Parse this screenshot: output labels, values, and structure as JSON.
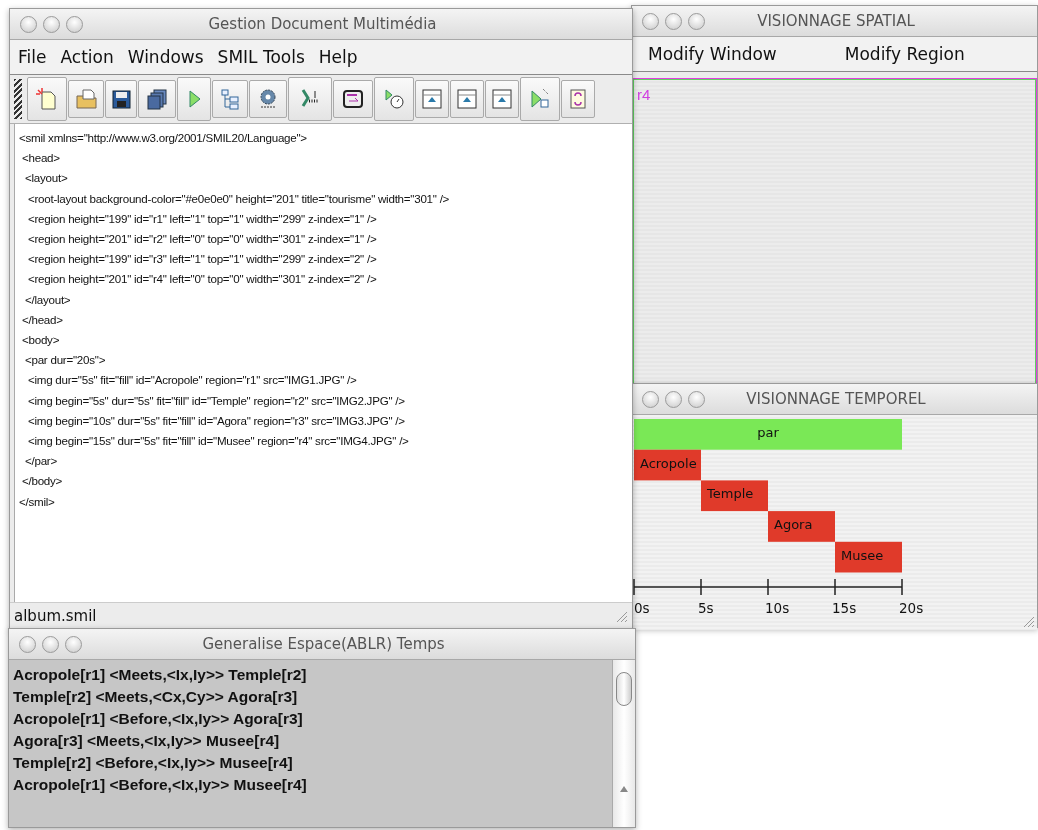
{
  "main_window": {
    "title": "Gestion Document Multimédia",
    "menu": [
      "File",
      "Action",
      "Windows",
      "SMIL Tools",
      "Help"
    ],
    "code_lines": [
      "<smil xmlns=\"http://www.w3.org/2001/SMIL20/Language\">",
      " <head>",
      "  <layout>",
      "   <root-layout background-color=\"#e0e0e0\" height=\"201\" title=\"tourisme\" width=\"301\" />",
      "   <region height=\"199\" id=\"r1\" left=\"1\" top=\"1\" width=\"299\" z-index=\"1\" />",
      "   <region height=\"201\" id=\"r2\" left=\"0\" top=\"0\" width=\"301\" z-index=\"1\" />",
      "   <region height=\"199\" id=\"r3\" left=\"1\" top=\"1\" width=\"299\" z-index=\"2\" />",
      "   <region height=\"201\" id=\"r4\" left=\"0\" top=\"0\" width=\"301\" z-index=\"2\" />",
      "  </layout>",
      " </head>",
      " <body>",
      "  <par dur=\"20s\">",
      "   <img dur=\"5s\" fit=\"fill\" id=\"Acropole\" region=\"r1\" src=\"IMG1.JPG\" />",
      "   <img begin=\"5s\" dur=\"5s\" fit=\"fill\" id=\"Temple\" region=\"r2\" src=\"IMG2.JPG\" />",
      "   <img begin=\"10s\" dur=\"5s\" fit=\"fill\" id=\"Agora\" region=\"r3\" src=\"IMG3.JPG\" />",
      "   <img begin=\"15s\" dur=\"5s\" fit=\"fill\" id=\"Musee\" region=\"r4\" src=\"IMG4.JPG\" />",
      "  </par>",
      " </body>",
      "</smil>"
    ],
    "status": "album.smil"
  },
  "spatial_window": {
    "title": "VISIONNAGE SPATIAL",
    "menu": [
      "Modify Window",
      "Modify Region"
    ],
    "region_label": "r4"
  },
  "temporal_window": {
    "title": "VISIONNAGE TEMPOREL",
    "timeline": {
      "ticks": [
        "0s",
        "5s",
        "10s",
        "15s",
        "20s"
      ],
      "items": [
        {
          "label": "par",
          "kind": "container",
          "color": "#7ae856"
        },
        {
          "label": "Acropole",
          "kind": "media",
          "color": "#e03a2a"
        },
        {
          "label": "Temple",
          "kind": "media",
          "color": "#e03a2a"
        },
        {
          "label": "Agora",
          "kind": "media",
          "color": "#e03a2a"
        },
        {
          "label": "Musee",
          "kind": "media",
          "color": "#e03a2a"
        }
      ]
    }
  },
  "relations_window": {
    "title": "Generalise Espace(ABLR) Temps",
    "relations": [
      "Acropole[r1] <Meets,<Ix,Iy>> Temple[r2]",
      "Temple[r2] <Meets,<Cx,Cy>> Agora[r3]",
      "Acropole[r1] <Before,<Ix,Iy>> Agora[r3]",
      "Agora[r3] <Meets,<Ix,Iy>> Musee[r4]",
      "Temple[r2] <Before,<Ix,Iy>> Musee[r4]",
      "Acropole[r1] <Before,<Ix,Iy>> Musee[r4]"
    ]
  }
}
